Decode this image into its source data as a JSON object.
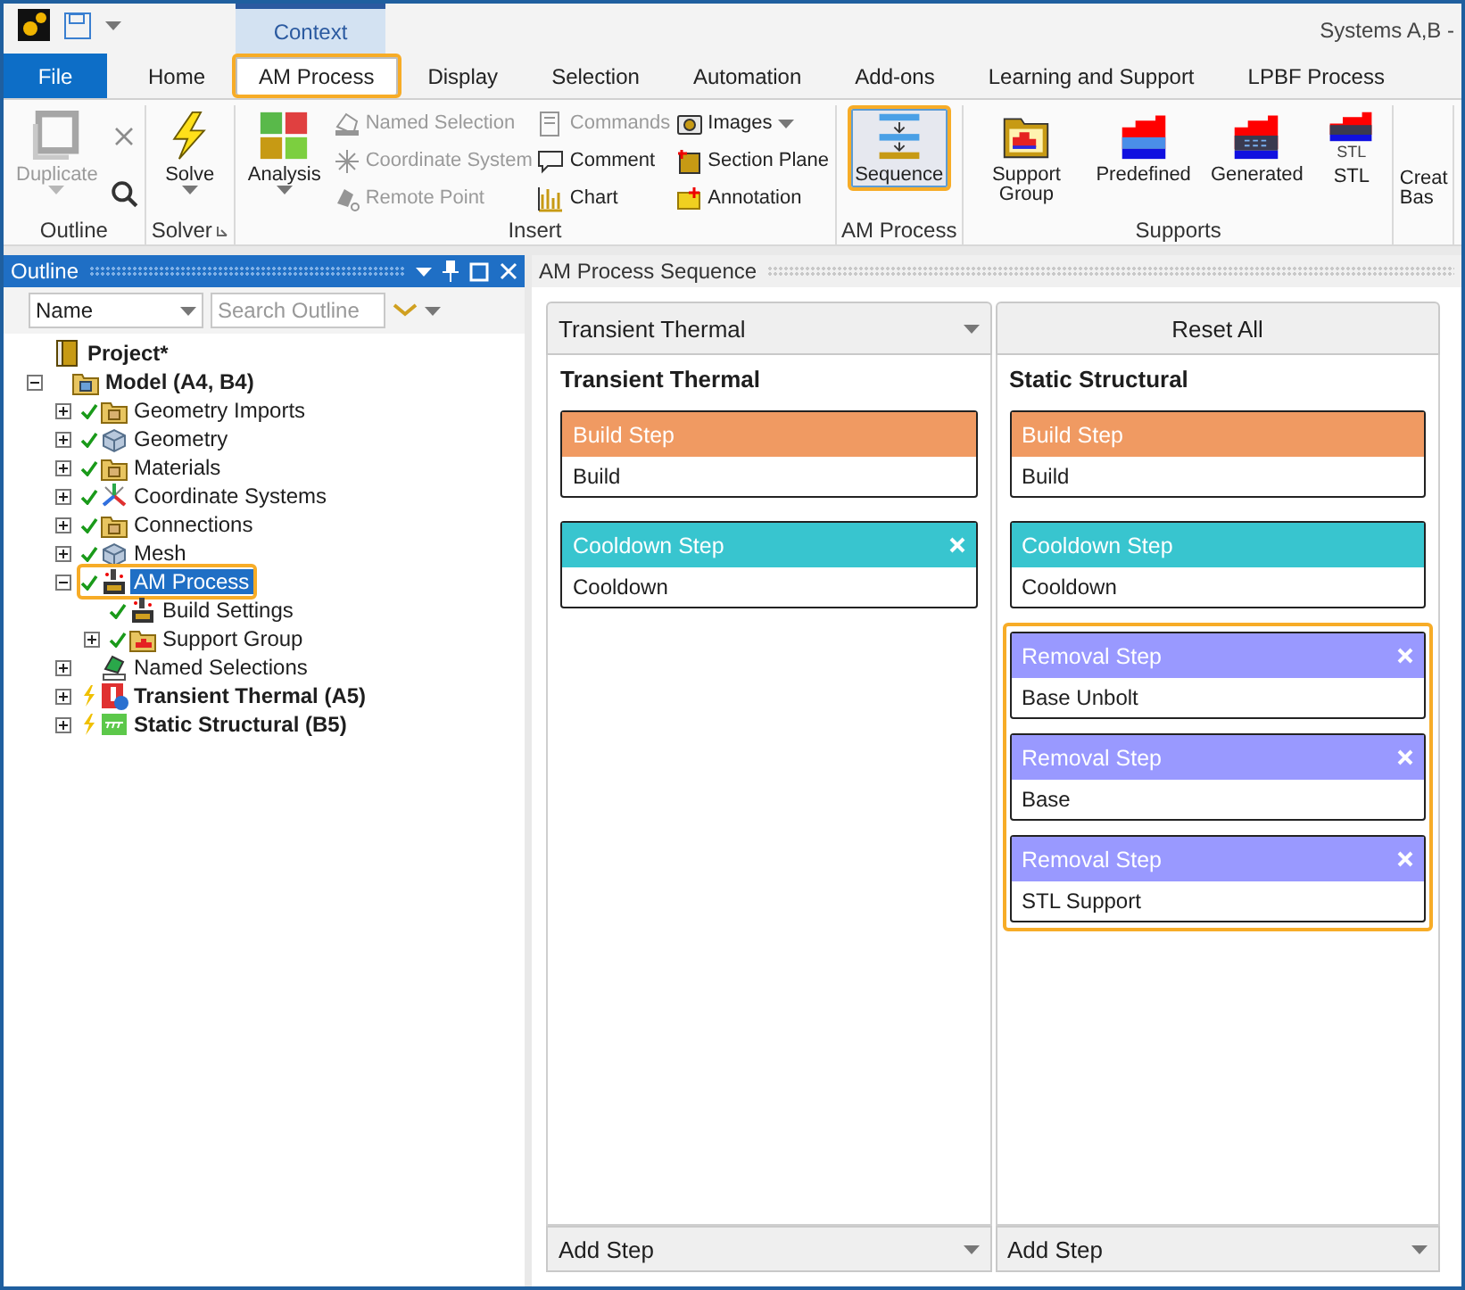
{
  "window": {
    "title": "Systems A,B -",
    "context_label": "Context"
  },
  "tabs": [
    {
      "label": "File",
      "kind": "file",
      "selected": false,
      "highlighted": false
    },
    {
      "label": "Home",
      "kind": "tab",
      "selected": false,
      "highlighted": false
    },
    {
      "label": "AM Process",
      "kind": "tab",
      "selected": true,
      "highlighted": true
    },
    {
      "label": "Display",
      "kind": "tab",
      "selected": false,
      "highlighted": false
    },
    {
      "label": "Selection",
      "kind": "tab",
      "selected": false,
      "highlighted": false
    },
    {
      "label": "Automation",
      "kind": "tab",
      "selected": false,
      "highlighted": false
    },
    {
      "label": "Add-ons",
      "kind": "tab",
      "selected": false,
      "highlighted": false
    },
    {
      "label": "Learning and Support",
      "kind": "tab",
      "selected": false,
      "highlighted": false
    },
    {
      "label": "LPBF Process",
      "kind": "tab",
      "selected": false,
      "highlighted": false
    }
  ],
  "ribbon": [
    {
      "label": "Outline",
      "launcher": false,
      "columns": [
        [
          {
            "kind": "large",
            "label": "Duplicate",
            "disabled": true,
            "dropdown": true,
            "highlighted": false
          }
        ],
        [
          {
            "kind": "icon",
            "disabled": true
          },
          {
            "kind": "icon",
            "disabled": false
          }
        ]
      ]
    },
    {
      "label": "Solver",
      "launcher": true,
      "columns": [
        [
          {
            "kind": "large",
            "label": "Solve",
            "disabled": false,
            "dropdown": true,
            "highlighted": false
          }
        ]
      ]
    },
    {
      "label": "Insert",
      "launcher": false,
      "columns": [
        [
          {
            "kind": "large",
            "label": "Analysis",
            "disabled": false,
            "dropdown": true,
            "highlighted": false
          }
        ],
        [
          {
            "kind": "small",
            "label": "Named Selection",
            "disabled": true,
            "dropdown": false
          },
          {
            "kind": "small",
            "label": "Coordinate System",
            "disabled": true,
            "dropdown": false
          },
          {
            "kind": "small",
            "label": "Remote Point",
            "disabled": true,
            "dropdown": false
          }
        ],
        [
          {
            "kind": "small",
            "label": "Commands",
            "disabled": true,
            "dropdown": false
          },
          {
            "kind": "small",
            "label": "Comment",
            "disabled": false,
            "dropdown": false
          },
          {
            "kind": "small",
            "label": "Chart",
            "disabled": false,
            "dropdown": false
          }
        ],
        [
          {
            "kind": "small",
            "label": "Images",
            "disabled": false,
            "dropdown": true
          },
          {
            "kind": "small",
            "label": "Section Plane",
            "disabled": false,
            "dropdown": false
          },
          {
            "kind": "small",
            "label": "Annotation",
            "disabled": false,
            "dropdown": false
          }
        ]
      ]
    },
    {
      "label": "AM Process",
      "launcher": false,
      "columns": [
        [
          {
            "kind": "large",
            "label": "Sequence",
            "disabled": false,
            "dropdown": false,
            "highlighted": true
          }
        ]
      ]
    },
    {
      "label": "Supports",
      "launcher": false,
      "columns": [
        [
          {
            "kind": "large",
            "label": "Support Group",
            "disabled": false,
            "dropdown": false,
            "highlighted": false
          }
        ],
        [
          {
            "kind": "large",
            "label": "Predefined",
            "disabled": false,
            "dropdown": false,
            "highlighted": false
          }
        ],
        [
          {
            "kind": "large",
            "label": "Generated",
            "disabled": false,
            "dropdown": false,
            "highlighted": false
          }
        ],
        [
          {
            "kind": "large",
            "label": "STL",
            "icon_label": "STL",
            "disabled": false,
            "dropdown": false,
            "highlighted": false
          }
        ]
      ]
    },
    {
      "columns": [
        [
          {
            "kind": "cut",
            "label": "Creat",
            "label2": "Bas"
          }
        ]
      ]
    }
  ],
  "outline": {
    "title": "Outline",
    "filter": {
      "value": "Name"
    },
    "search": {
      "placeholder": "Search Outline"
    },
    "tree": [
      {
        "label": "Project*",
        "bold": true,
        "kind": "project",
        "selected": false,
        "highlighted": false,
        "children": [
          {
            "label": "Model (A4, B4)",
            "bold": true,
            "kind": "model",
            "expanded": true,
            "selected": false,
            "highlighted": false,
            "children": [
              {
                "label": "Geometry Imports",
                "bold": false,
                "kind": "folder",
                "checked": true,
                "expanded": false,
                "selected": false,
                "highlighted": false
              },
              {
                "label": "Geometry",
                "bold": false,
                "kind": "cube",
                "checked": true,
                "expanded": false,
                "selected": false,
                "highlighted": false
              },
              {
                "label": "Materials",
                "bold": false,
                "kind": "folder",
                "checked": true,
                "expanded": false,
                "selected": false,
                "highlighted": false
              },
              {
                "label": "Coordinate Systems",
                "bold": false,
                "kind": "coords",
                "checked": true,
                "expanded": false,
                "selected": false,
                "highlighted": false
              },
              {
                "label": "Connections",
                "bold": false,
                "kind": "folder",
                "checked": true,
                "expanded": false,
                "selected": false,
                "highlighted": false
              },
              {
                "label": "Mesh",
                "bold": false,
                "kind": "cube",
                "checked": true,
                "expanded": false,
                "selected": false,
                "highlighted": false
              },
              {
                "label": "AM Process",
                "bold": false,
                "kind": "machine",
                "checked": true,
                "expanded": true,
                "selected": true,
                "highlighted": true,
                "children": [
                  {
                    "label": "Build Settings",
                    "bold": false,
                    "kind": "machine",
                    "checked": true,
                    "selected": false,
                    "highlighted": false
                  },
                  {
                    "label": "Support Group",
                    "bold": false,
                    "kind": "supportfolder",
                    "checked": true,
                    "expanded": false,
                    "selected": false,
                    "highlighted": false
                  }
                ]
              },
              {
                "label": "Named Selections",
                "bold": false,
                "kind": "named",
                "expanded": false,
                "selected": false,
                "highlighted": false
              },
              {
                "label": "Transient Thermal (A5)",
                "bold": true,
                "kind": "thermal",
                "needs_solve": true,
                "expanded": false,
                "selected": false,
                "highlighted": false
              },
              {
                "label": "Static Structural (B5)",
                "bold": true,
                "kind": "structural",
                "needs_solve": true,
                "expanded": false,
                "selected": false,
                "highlighted": false
              }
            ]
          }
        ]
      }
    ]
  },
  "sequence": {
    "title": "AM Process Sequence",
    "columns": [
      {
        "header": {
          "kind": "dropdown",
          "label": "Transient Thermal"
        },
        "title": "Transient Thermal",
        "footer": "Add Step",
        "steps": [
          {
            "title": "Build Step",
            "body": "Build",
            "color": "#f09a62",
            "closable": false,
            "highlighted": false
          },
          {
            "title": "Cooldown Step",
            "body": "Cooldown",
            "color": "#38c5cf",
            "closable": true,
            "highlighted": false
          }
        ]
      },
      {
        "header": {
          "kind": "button",
          "label": "Reset All"
        },
        "title": "Static Structural",
        "footer": "Add Step",
        "steps": [
          {
            "title": "Build Step",
            "body": "Build",
            "color": "#f09a62",
            "closable": false,
            "highlighted": false
          },
          {
            "title": "Cooldown Step",
            "body": "Cooldown",
            "color": "#38c5cf",
            "closable": false,
            "highlighted": false
          },
          {
            "title": "Removal Step",
            "body": "Base Unbolt",
            "color": "#9999ff",
            "closable": true,
            "highlighted": true
          },
          {
            "title": "Removal Step",
            "body": "Base",
            "color": "#9999ff",
            "closable": true,
            "highlighted": true
          },
          {
            "title": "Removal Step",
            "body": "STL Support",
            "color": "#9999ff",
            "closable": true,
            "highlighted": true
          }
        ]
      }
    ]
  }
}
